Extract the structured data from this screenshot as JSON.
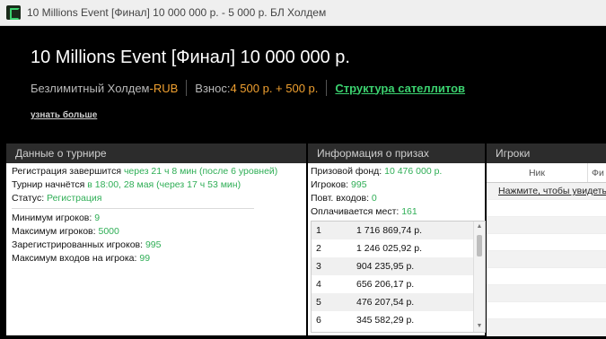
{
  "window": {
    "title": "10 Millions Event [Финал] 10 000 000 р.  - 5 000 р. БЛ Холдем"
  },
  "header": {
    "event_title": "10 Millions Event [Финал] 10 000 000 р.",
    "game_type": "Безлимитный Холдем",
    "currency_sep": " - ",
    "currency": "RUB",
    "buyin_label": "Взнос: ",
    "buyin_value": "4 500 р. + 500 р.",
    "satellites_link": "Структура сателлитов",
    "learn_more": "узнать больше"
  },
  "tournament": {
    "title": "Данные о турнире",
    "reg_ends_label": "Регистрация завершится ",
    "reg_ends_value": "через 21 ч 8 мин (после 6 уровней)",
    "start_label": "Турнир начнётся ",
    "start_value": "в 18:00, 28 мая (через 17 ч 53 мин)",
    "status_label": "Статус: ",
    "status_value": "Регистрация",
    "min_players_label": "Минимум игроков: ",
    "min_players_value": "9",
    "max_players_label": "Максимум игроков: ",
    "max_players_value": "5000",
    "registered_label": "Зарегистрированных игроков: ",
    "registered_value": "995",
    "max_entries_label": "Максимум входов на игрока: ",
    "max_entries_value": "99"
  },
  "prizes": {
    "title": "Информация о призах",
    "pool_label": "Призовой фонд: ",
    "pool_value": "10 476 000 р.",
    "players_label": "Игроков: ",
    "players_value": "995",
    "reentries_label": "Повт. входов: ",
    "reentries_value": "0",
    "paid_label": "Оплачивается мест: ",
    "paid_value": "161",
    "table": [
      {
        "place": "1",
        "amount": "1 716 869,74 р."
      },
      {
        "place": "2",
        "amount": "1 246 025,92 р."
      },
      {
        "place": "3",
        "amount": "904 235,95 р."
      },
      {
        "place": "4",
        "amount": "656 206,17 р."
      },
      {
        "place": "5",
        "amount": "476 207,54 р."
      },
      {
        "place": "6",
        "amount": "345 582,29 р."
      }
    ]
  },
  "players": {
    "title": "Игроки",
    "col_nick": "Ник",
    "col_chips": "Фи",
    "click_text": "Нажмите, чтобы увидеть"
  }
}
